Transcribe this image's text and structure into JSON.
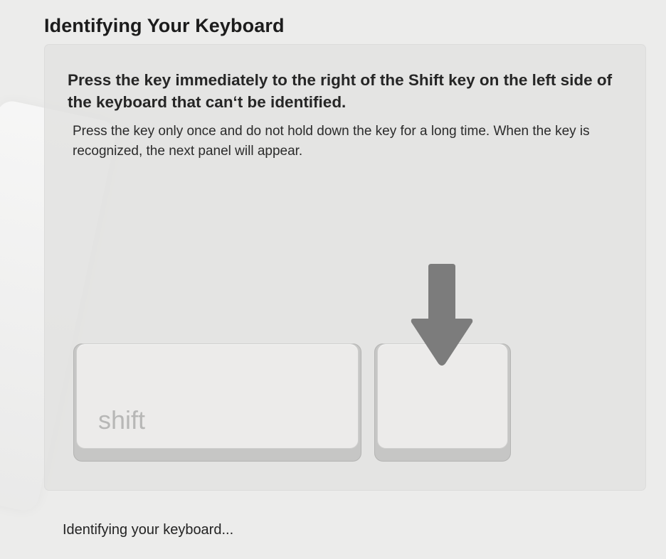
{
  "header": {
    "title": "Identifying Your Keyboard"
  },
  "panel": {
    "headline": "Press the key immediately to the right of the Shift key on the left side of the keyboard that can‘t be identified.",
    "instructions": "Press the key only once and do not hold down the key for a long time. When the key is recognized, the next panel will appear.",
    "keys": {
      "shift_label": "shift"
    },
    "icons": {
      "arrow": "arrow-down-icon"
    }
  },
  "footer": {
    "status": "Identifying your keyboard..."
  },
  "colors": {
    "background": "#ececeb",
    "panel": "#e3e3e2",
    "key_cap": "#ecebea",
    "key_base": "#c6c6c5",
    "arrow": "#7c7c7c",
    "shift_label": "#b7b7b6"
  }
}
